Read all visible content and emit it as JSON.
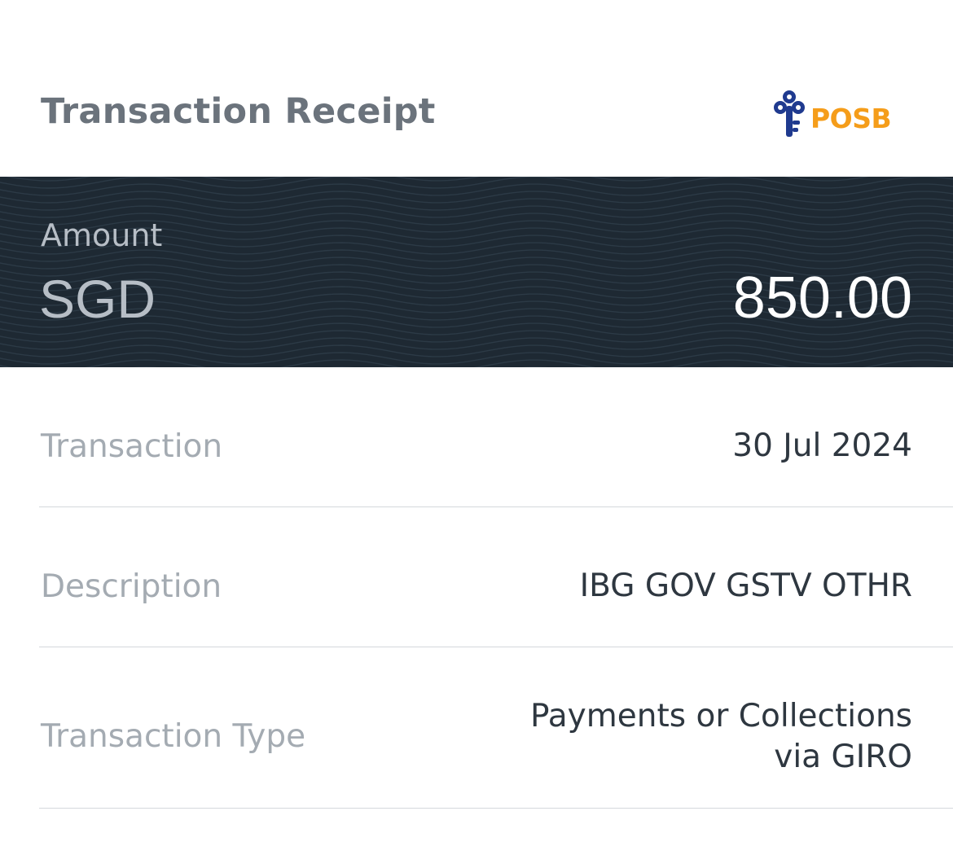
{
  "header": {
    "title": "Transaction Receipt",
    "logo": {
      "icon": "posb-key-icon",
      "text": "POSB",
      "icon_color": "#1f3a8f",
      "text_color": "#f59d1a"
    }
  },
  "amount": {
    "label": "Amount",
    "currency": "SGD",
    "value": "850.00",
    "background_color": "#1e2933"
  },
  "details": [
    {
      "label": "Transaction",
      "value": "30 Jul 2024"
    },
    {
      "label": "Description",
      "value": "IBG GOV GSTV OTHR"
    },
    {
      "label": "Transaction Type",
      "value_line1": "Payments or Collections",
      "value_line2": "via GIRO"
    }
  ]
}
